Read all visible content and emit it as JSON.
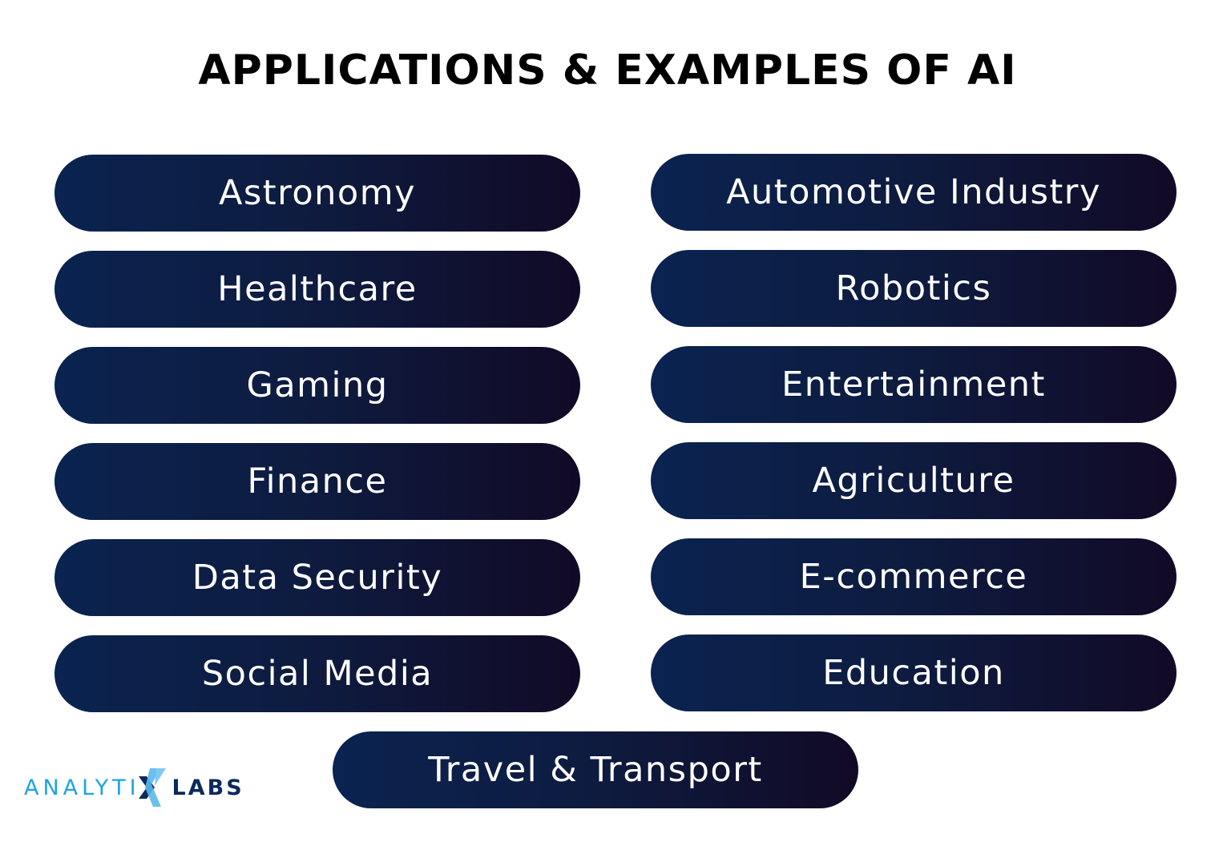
{
  "title": "APPLICATIONS & EXAMPLES OF AI",
  "left_column": [
    {
      "label": "Astronomy"
    },
    {
      "label": "Healthcare"
    },
    {
      "label": "Gaming"
    },
    {
      "label": "Finance"
    },
    {
      "label": "Data Security"
    },
    {
      "label": "Social Media"
    }
  ],
  "right_column": [
    {
      "label": "Automotive Industry"
    },
    {
      "label": "Robotics"
    },
    {
      "label": "Entertainment"
    },
    {
      "label": "Agriculture"
    },
    {
      "label": "E-commerce"
    },
    {
      "label": "Education"
    }
  ],
  "bottom": {
    "label": "Travel & Transport"
  },
  "logo": {
    "part1": "ANALYTI",
    "part2": "LABS",
    "icon": "x-logo-mark"
  },
  "colors": {
    "pill_start": "#0a2350",
    "pill_end": "#110a26",
    "logo_light": "#1ea3e6",
    "logo_dark": "#0a2a5c"
  }
}
